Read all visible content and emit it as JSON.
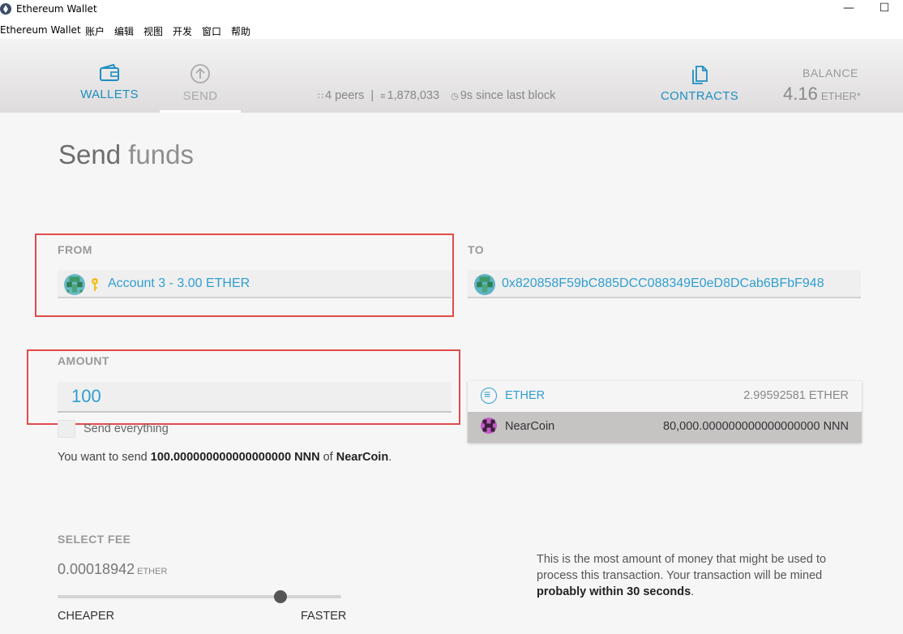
{
  "window": {
    "title": "Ethereum Wallet",
    "minimize": "—",
    "maximize": "☐"
  },
  "menu": [
    "Ethereum Wallet",
    "账户",
    "编辑",
    "视图",
    "开发",
    "窗口",
    "帮助"
  ],
  "nav": {
    "wallets": "WALLETS",
    "send": "SEND",
    "contracts": "CONTRACTS"
  },
  "network": {
    "peers": "4 peers",
    "block": "1,878,033",
    "since": "9s since last block"
  },
  "balance": {
    "label": "BALANCE",
    "value": "4.16",
    "unit": "ETHER*"
  },
  "page": {
    "title_main": "Send",
    "title_light": "funds"
  },
  "from": {
    "label": "FROM",
    "account": "Account 3 - 3.00 ETHER"
  },
  "to": {
    "label": "TO",
    "address": "0x820858F59bC885DCC088349E0eD8DCab6BFbF948"
  },
  "amount": {
    "label": "AMOUNT",
    "value": "100",
    "send_everything": "Send everything",
    "summary_prefix": "You want to send",
    "summary_amount": "100.000000000000000000 NNN",
    "summary_of": "of",
    "summary_token": "NearCoin",
    "summary_end": "."
  },
  "tokens": [
    {
      "name": "ETHER",
      "balance": "2.99592581 ETHER"
    },
    {
      "name": "NearCoin",
      "balance": "80,000.000000000000000000 NNN"
    }
  ],
  "fee": {
    "label": "SELECT FEE",
    "value": "0.00018942",
    "unit": "ETHER",
    "slider_level": 0.787,
    "cheaper": "CHEAPER",
    "faster": "FASTER",
    "note_text": "This is the most amount of money that might be used to process this transaction. Your transaction will be mined",
    "note_bold": "probably within 30 seconds",
    "note_end": "."
  },
  "colors": {
    "accent": "#1e8fc2",
    "highlight": "#e04b4b"
  }
}
